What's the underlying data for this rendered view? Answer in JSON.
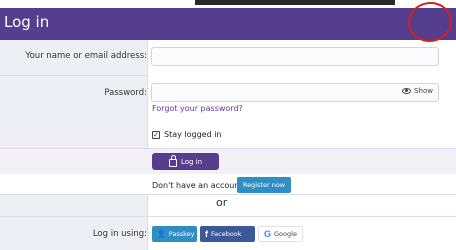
{
  "header": {
    "title": "Log in"
  },
  "form": {
    "username_label": "Your name or email address:",
    "username_value": "",
    "password_label": "Password:",
    "password_value": "",
    "show_label": "Show",
    "forgot_link": "Forgot your password?",
    "stay_logged_in_label": "Stay logged in",
    "stay_logged_in_checked": true,
    "login_button": "Log in"
  },
  "register": {
    "prompt": "Don't have an account?",
    "button": "Register now"
  },
  "separator_text": "or",
  "social": {
    "label": "Log in using:",
    "buttons": [
      {
        "label": "Passkey",
        "icon": "passkey-icon"
      },
      {
        "label": "Facebook",
        "icon": "facebook-icon"
      },
      {
        "label": "Google",
        "icon": "google-icon"
      }
    ]
  },
  "colors": {
    "header": "#553e8e",
    "primary_button": "#553e8e",
    "accent_blue": "#2f8fc3",
    "facebook": "#3b5998",
    "annotation_circle": "#d62020"
  }
}
